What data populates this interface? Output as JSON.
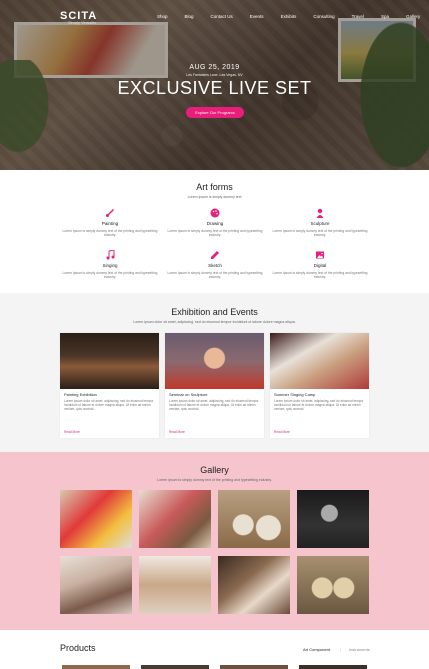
{
  "nav": {
    "logo": "SCITA",
    "logo_sub": "Simply Versatile",
    "links": [
      "Shop",
      "Blog",
      "Contact Us",
      "Events",
      "Exhibits",
      "Consulting",
      "Travel",
      "Spa",
      "Gallery"
    ]
  },
  "hero": {
    "date": "AUG 25, 2019",
    "location": "Les Fantaisies Lane, Las Vegas, NV",
    "title": "EXCLUSIVE LIVE SET",
    "button": "Explore Our Programs"
  },
  "art_forms": {
    "title": "Art forms",
    "subtitle": "Lorem Ipsum is simply dummy text",
    "items": [
      {
        "name": "Painting",
        "icon": "paintbrush-icon",
        "desc": "Lorem Ipsum is simply dummy text of the printing and typesetting industry."
      },
      {
        "name": "Drawing",
        "icon": "palette-icon",
        "desc": "Lorem Ipsum is simply dummy text of the printing and typesetting industry."
      },
      {
        "name": "Sculpture",
        "icon": "bust-icon",
        "desc": "Lorem Ipsum is simply dummy text of the printing and typesetting industry."
      },
      {
        "name": "Singing",
        "icon": "music-note-icon",
        "desc": "Lorem Ipsum is simply dummy text of the printing and typesetting industry."
      },
      {
        "name": "Sketch",
        "icon": "pencil-icon",
        "desc": "Lorem Ipsum is simply dummy text of the printing and typesetting industry."
      },
      {
        "name": "Digital",
        "icon": "image-icon",
        "desc": "Lorem Ipsum is simply dummy text of the printing and typesetting industry."
      }
    ]
  },
  "exhibition": {
    "title": "Exhibition and Events",
    "subtitle": "Lorem ipsum dolor sit amet, adipiscing, sed do eiusmod tempor incididunt ut labore dolore magna aliqua.",
    "cards": [
      {
        "title": "Painting Exhibition",
        "desc": "Lorem ipsum dolor sit amet, adipiscing, sed do eiusmod tempor incididunt ut labore et dolore magna aliqua. Ut enim ad minim veniam, quis nostrud.",
        "link": "Read More"
      },
      {
        "title": "Seminar on Sculpture",
        "desc": "Lorem ipsum dolor sit amet, adipiscing, sed do eiusmod tempor incididunt ut labore et dolore magna aliqua. Ut enim ad minim veniam, quis nostrud.",
        "link": "Read More"
      },
      {
        "title": "Summer Singing Camp",
        "desc": "Lorem ipsum dolor sit amet, adipiscing, sed do eiusmod tempor incididunt ut labore et dolore magna aliqua. Ut enim ad minim veniam, quis nostrud.",
        "link": "Read More"
      }
    ]
  },
  "gallery": {
    "title": "Gallery",
    "subtitle": "Lorem Ipsum is simply dummy text of the printing and typesetting industry."
  },
  "products": {
    "title": "Products",
    "tabs": [
      "Art Component",
      "Instruments"
    ]
  },
  "colors": {
    "accent": "#e91e7a",
    "gallery_bg": "#f5c4cd",
    "exhibit_bg": "#f4f4f4"
  }
}
